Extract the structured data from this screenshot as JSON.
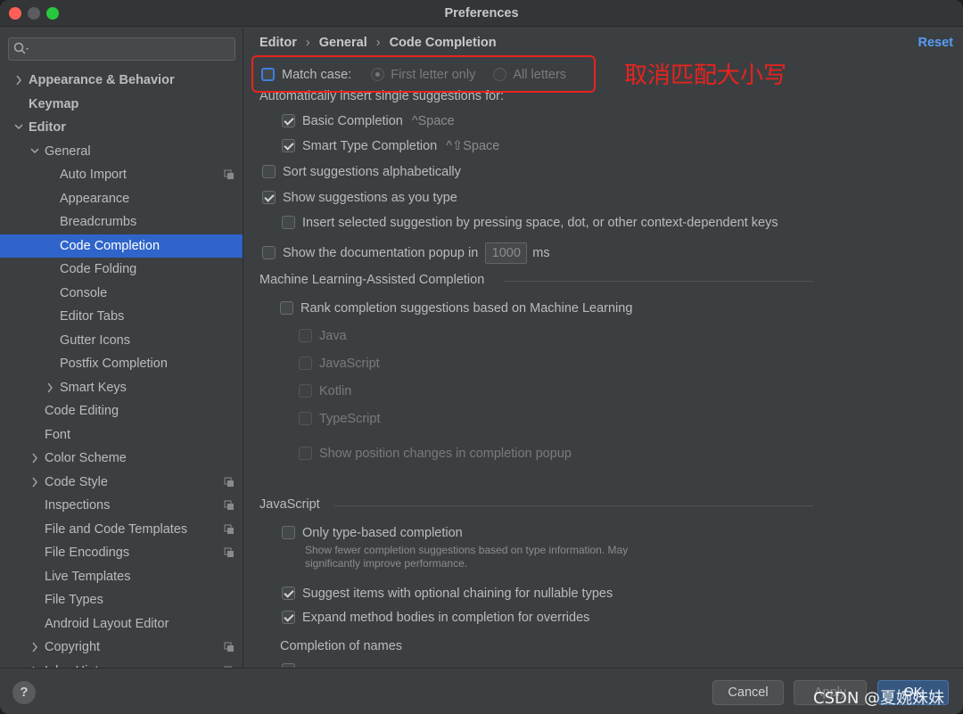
{
  "window": {
    "title": "Preferences"
  },
  "sidebar": {
    "search_placeholder": "",
    "items": [
      {
        "label": "Appearance & Behavior",
        "bold": true,
        "arrow": "right"
      },
      {
        "label": "Keymap",
        "bold": true
      },
      {
        "label": "Editor",
        "bold": true,
        "arrow": "down"
      },
      {
        "label": "General",
        "arrow": "down"
      },
      {
        "label": "Auto Import",
        "copy": true
      },
      {
        "label": "Appearance"
      },
      {
        "label": "Breadcrumbs"
      },
      {
        "label": "Code Completion",
        "selected": true
      },
      {
        "label": "Code Folding"
      },
      {
        "label": "Console"
      },
      {
        "label": "Editor Tabs"
      },
      {
        "label": "Gutter Icons"
      },
      {
        "label": "Postfix Completion"
      },
      {
        "label": "Smart Keys",
        "arrow": "right"
      },
      {
        "label": "Code Editing"
      },
      {
        "label": "Font"
      },
      {
        "label": "Color Scheme",
        "arrow": "right"
      },
      {
        "label": "Code Style",
        "arrow": "right",
        "copy": true
      },
      {
        "label": "Inspections",
        "copy": true
      },
      {
        "label": "File and Code Templates",
        "copy": true
      },
      {
        "label": "File Encodings",
        "copy": true
      },
      {
        "label": "Live Templates"
      },
      {
        "label": "File Types"
      },
      {
        "label": "Android Layout Editor"
      },
      {
        "label": "Copyright",
        "arrow": "right",
        "copy": true
      },
      {
        "label": "Inlay Hints",
        "arrow": "right",
        "copy": true
      }
    ]
  },
  "breadcrumb": {
    "part1": "Editor",
    "part2": "General",
    "part3": "Code Completion"
  },
  "reset_label": "Reset",
  "match_case": {
    "label": "Match case:",
    "first_letter": "First letter only",
    "all_letters": "All letters"
  },
  "annotation": "取消匹配大小写",
  "auto_insert": {
    "title": "Automatically insert single suggestions for:",
    "basic": "Basic Completion",
    "basic_shortcut": "^Space",
    "smart": "Smart Type Completion",
    "smart_shortcut": "^⇧Space"
  },
  "sort_alpha": "Sort suggestions alphabetically",
  "show_as_type": "Show suggestions as you type",
  "insert_selected": "Insert selected suggestion by pressing space, dot, or other context-dependent keys",
  "doc_popup": {
    "label": "Show the documentation popup in",
    "value": "1000",
    "unit": "ms"
  },
  "ml": {
    "title": "Machine Learning-Assisted Completion",
    "rank": "Rank completion suggestions based on Machine Learning",
    "java": "Java",
    "javascript": "JavaScript",
    "kotlin": "Kotlin",
    "typescript": "TypeScript",
    "position_changes": "Show position changes in completion popup"
  },
  "js": {
    "title": "JavaScript",
    "only_type": "Only type-based completion",
    "only_type_hint": "Show fewer completion suggestions based on type information. May significantly improve performance.",
    "optional_chaining": "Suggest items with optional chaining for nullable types",
    "expand_method": "Expand method bodies in completion for overrides",
    "names_title": "Completion of names"
  },
  "footer": {
    "help": "?",
    "cancel": "Cancel",
    "apply": "Apply",
    "ok": "OK"
  },
  "watermark": "CSDN @夏婉妹妹",
  "colors": {
    "accent": "#2f65ca",
    "link": "#589df6",
    "annotation": "#e8231e"
  }
}
